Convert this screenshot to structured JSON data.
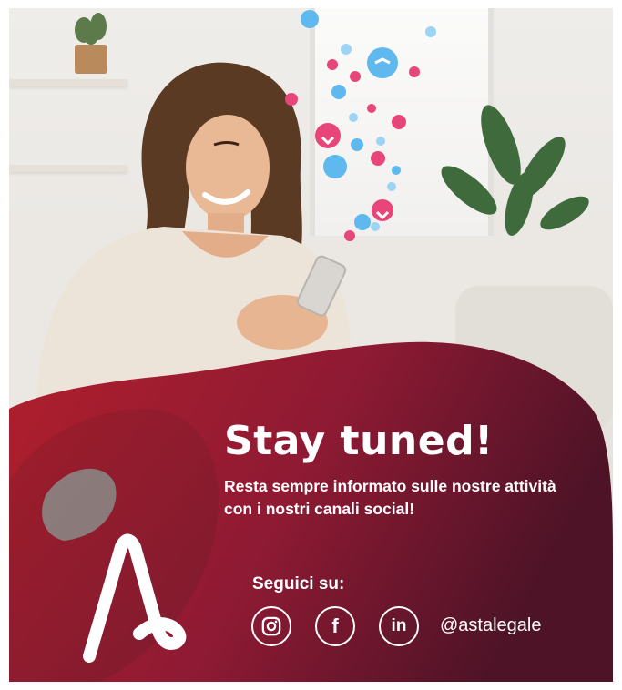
{
  "banner": {
    "headline": "Stay tuned!",
    "subtitle": "Resta sempre informato sulle nostre attività con i nostri canali social!",
    "follow_label": "Seguici su:",
    "handle": "@astalegale"
  },
  "social": [
    {
      "name": "instagram",
      "icon": "instagram-icon"
    },
    {
      "name": "facebook",
      "icon": "facebook-icon",
      "glyph": "f"
    },
    {
      "name": "linkedin",
      "icon": "linkedin-icon",
      "glyph": "in"
    }
  ],
  "photo": {
    "description_icons": [
      "heart-icon",
      "bird-icon"
    ]
  },
  "colors": {
    "brand_red": "#a51f2e",
    "brand_dark": "#4e1327",
    "heart_pink": "#e8457a",
    "bird_blue": "#5fb8ee",
    "text": "#ffffff"
  }
}
